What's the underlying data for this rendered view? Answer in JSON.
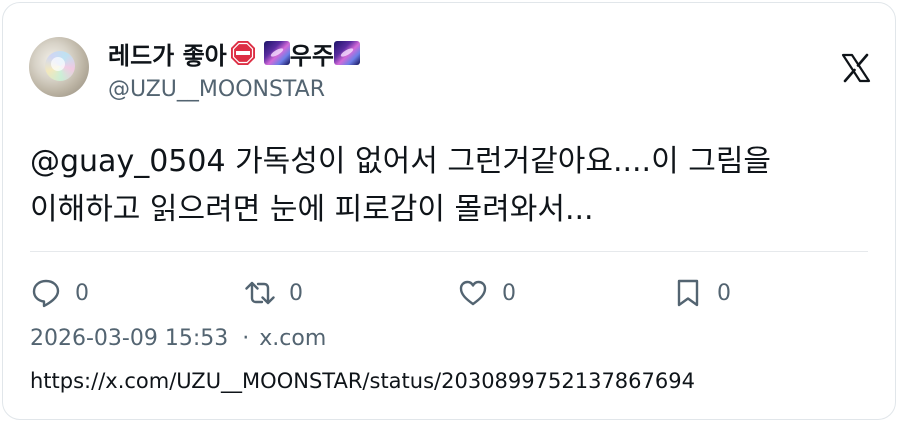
{
  "author": {
    "display_name_part1": "레드가 좋아",
    "display_name_part2": "우주",
    "handle": "@UZU__MOONSTAR"
  },
  "tweet": {
    "text_line1": "@guay_0504 가독성이 없어서 그런거같아요....이 그림을",
    "text_line2": "이해하고 읽으려면 눈에 피로감이 몰려와서..."
  },
  "actions": {
    "reply_count": "0",
    "retweet_count": "0",
    "like_count": "0",
    "bookmark_count": "0"
  },
  "meta": {
    "timestamp": "2026-03-09 15:53",
    "separator": "·",
    "source": "x.com"
  },
  "url": "https://x.com/UZU__MOONSTAR/status/2030899752137867694",
  "icons": {
    "stop": "stop-sign-icon",
    "galaxy": "milky-way-icon",
    "x_logo": "x-logo-icon",
    "reply": "reply-icon",
    "retweet": "retweet-icon",
    "like": "heart-icon",
    "bookmark": "bookmark-icon"
  },
  "colors": {
    "text_primary": "#0f1419",
    "text_secondary": "#536471",
    "stop_red": "#dd2e44",
    "border": "#e1e6ea"
  }
}
